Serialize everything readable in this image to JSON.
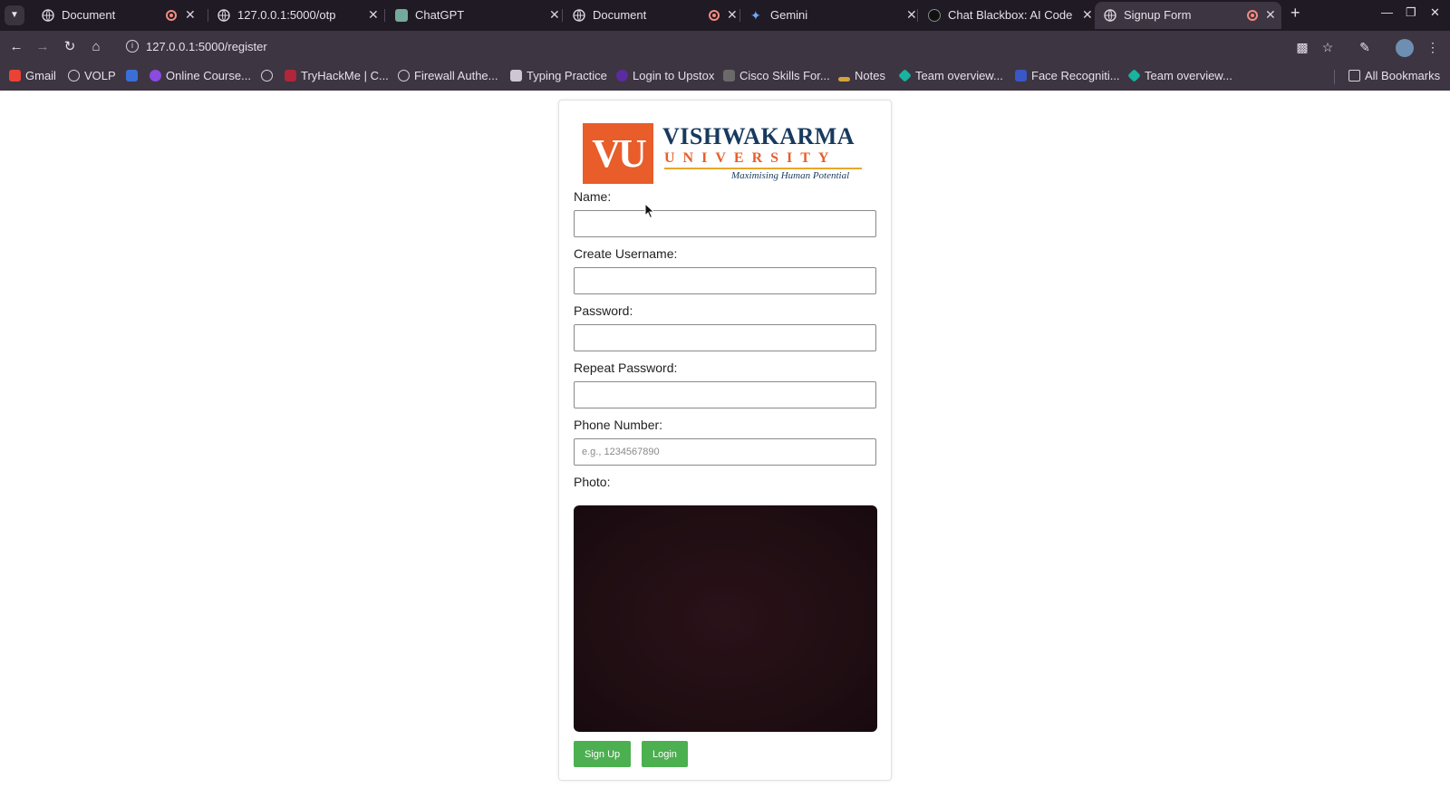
{
  "browser": {
    "tabs": [
      {
        "title": "Document",
        "recording": true
      },
      {
        "title": "127.0.0.1:5000/otp",
        "recording": false
      },
      {
        "title": "ChatGPT",
        "recording": false
      },
      {
        "title": "Document",
        "recording": true
      },
      {
        "title": "Gemini",
        "recording": false
      },
      {
        "title": "Chat Blackbox: AI Code G",
        "recording": false
      },
      {
        "title": "Signup Form",
        "recording": true,
        "active": true
      }
    ],
    "url": "127.0.0.1:5000/register",
    "bookmarks": [
      "Gmail",
      "VOLP",
      "",
      "Online Course...",
      "",
      "TryHackMe | C...",
      "Firewall Authe...",
      "Typing Practice",
      "Login to Upstox",
      "Cisco Skills For...",
      "Notes",
      "Team overview...",
      "Face Recogniti...",
      "Team overview..."
    ],
    "all_bookmarks": "All Bookmarks"
  },
  "page": {
    "logo": {
      "mark": "VU",
      "name": "VISHWAKARMA",
      "subtitle": "UNIVERSITY",
      "tagline": "Maximising Human Potential"
    },
    "form": {
      "name_label": "Name:",
      "username_label": "Create Username:",
      "password_label": "Password:",
      "repeat_password_label": "Repeat Password:",
      "phone_label": "Phone Number:",
      "phone_placeholder": "e.g., 1234567890",
      "photo_label": "Photo:"
    },
    "buttons": {
      "signup": "Sign Up",
      "login": "Login"
    }
  },
  "colors": {
    "brand_orange": "#e85d2a",
    "brand_navy": "#173a5e",
    "button_green": "#4caf50"
  }
}
